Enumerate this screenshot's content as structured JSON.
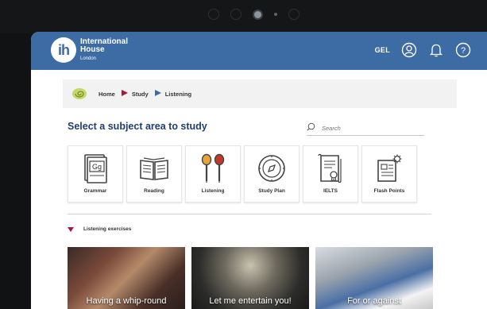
{
  "header": {
    "logo_mark": "ih",
    "logo_line1": "International",
    "logo_line2": "House",
    "logo_line3": "London",
    "level": "GEL"
  },
  "breadcrumb": {
    "items": [
      "Home",
      "Study",
      "Listening"
    ],
    "colors": [
      "#a01b3c",
      "#3d6ca5"
    ]
  },
  "main": {
    "title": "Select a subject area to study",
    "search_placeholder": "Search"
  },
  "subjects": [
    {
      "label": "Grammar",
      "icon": "grammar-book-icon"
    },
    {
      "label": "Reading",
      "icon": "open-book-icon"
    },
    {
      "label": "Listening",
      "icon": "earphones-icon"
    },
    {
      "label": "Study Plan",
      "icon": "compass-icon"
    },
    {
      "label": "IELTS",
      "icon": "certificate-icon"
    },
    {
      "label": "Flash Points",
      "icon": "newspaper-gear-icon"
    }
  ],
  "section": {
    "label": "Listening exercises"
  },
  "exercises": [
    {
      "label": "Having a whip-round"
    },
    {
      "label": "Let me entertain you!"
    },
    {
      "label": "For or against"
    }
  ],
  "colors": {
    "header": "#3d6ca5",
    "title": "#1f3f6d",
    "accent": "#a01b3c"
  }
}
